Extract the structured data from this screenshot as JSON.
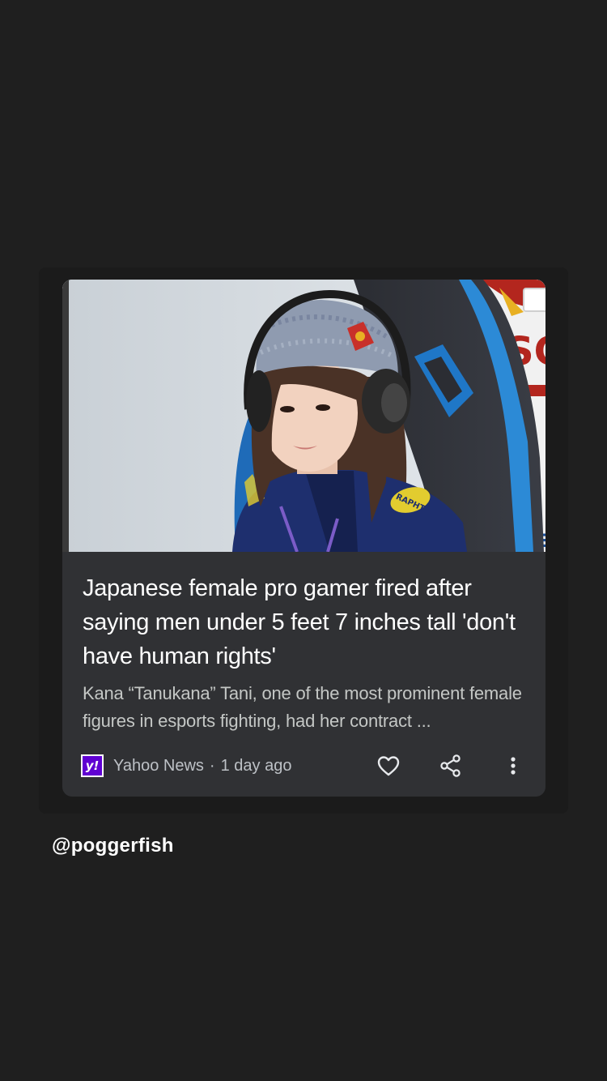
{
  "article": {
    "headline": "Japanese female pro gamer fired after saying men under 5 feet 7 inches tall 'don't have human rights'",
    "snippet": "Kana “Tanukana” Tani, one of the most prominent female figures in esports fighting, had her contract ...",
    "source": "Yahoo News",
    "separator": "·",
    "age": "1 day ago",
    "source_logo_text": "y!"
  },
  "actions": {
    "like_icon": "heart-icon",
    "share_icon": "share-icon",
    "more_icon": "more-vert-icon"
  },
  "story": {
    "handle": "@poggerfish"
  },
  "colors": {
    "background": "#1f1f1f",
    "card": "#303134",
    "yahoo_purple": "#6001d2"
  }
}
